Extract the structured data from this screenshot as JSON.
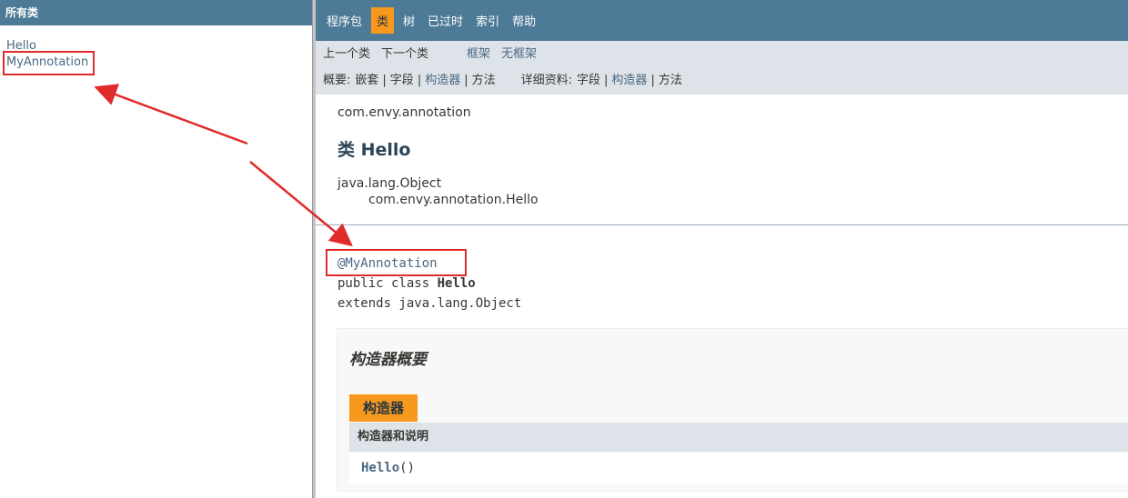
{
  "left": {
    "header": "所有类",
    "classes": [
      "Hello",
      "MyAnnotation"
    ]
  },
  "nav": {
    "items": [
      "程序包",
      "类",
      "树",
      "已过时",
      "索引",
      "帮助"
    ],
    "active": "类"
  },
  "subnav": {
    "prev_class": "上一个类",
    "next_class": "下一个类",
    "frames": "框架",
    "no_frames": "无框架",
    "summary_label": "概要:",
    "summary_items": [
      "嵌套",
      "字段",
      "构造器",
      "方法"
    ],
    "detail_label": "详细资料:",
    "detail_items": [
      "字段",
      "构造器",
      "方法"
    ]
  },
  "content": {
    "package": "com.envy.annotation",
    "title": "类 Hello",
    "inheritance": [
      "java.lang.Object",
      "com.envy.annotation.Hello"
    ],
    "signature": {
      "annotation": "@MyAnnotation",
      "decl_prefix": "public class ",
      "class_name": "Hello",
      "extends": "extends java.lang.Object"
    },
    "constructor_summary": {
      "title": "构造器概要",
      "tab": "构造器",
      "column_header": "构造器和说明",
      "constructor_name": "Hello",
      "constructor_params": "()"
    }
  },
  "colors": {
    "nav_bg": "#4d7a97",
    "active_tab": "#f8981d",
    "subnav_bg": "#dee3e9",
    "annotation_red": "#e02b2b"
  }
}
